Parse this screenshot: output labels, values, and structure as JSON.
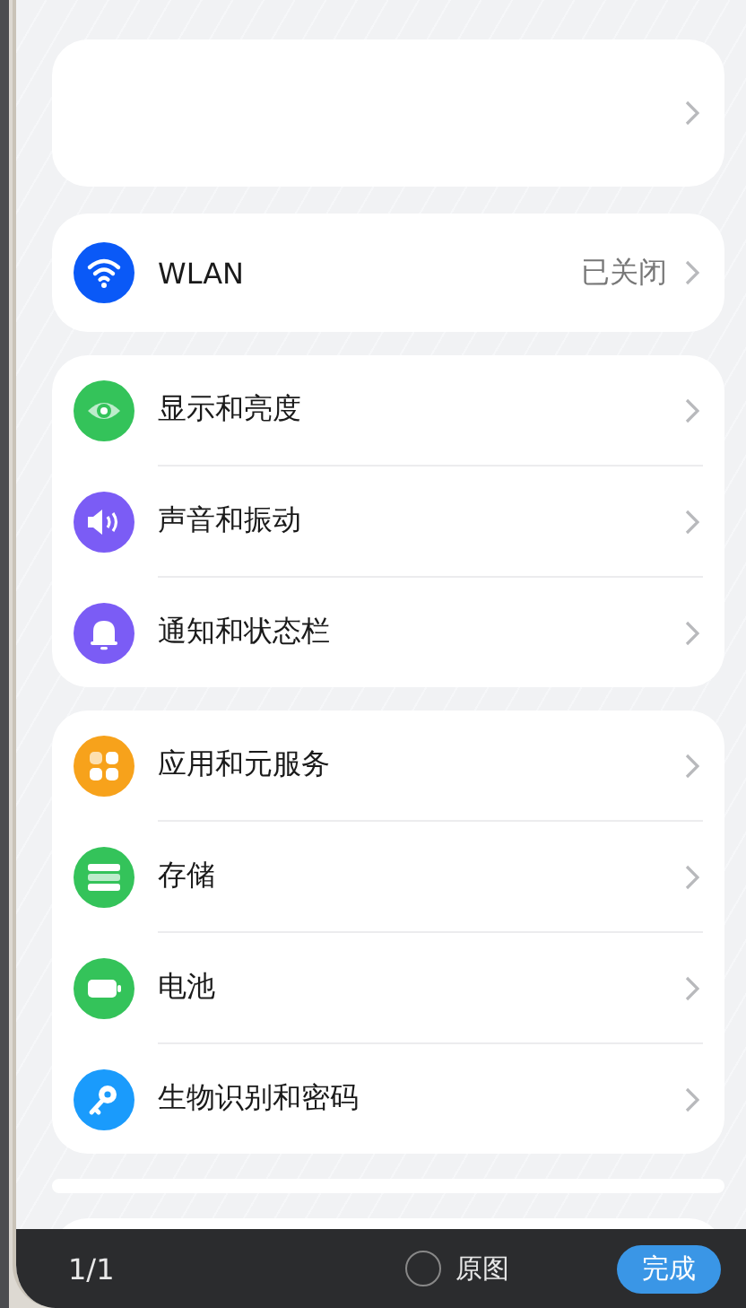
{
  "groups": [
    {
      "items": [
        {
          "kind": "empty"
        }
      ]
    },
    {
      "items": [
        {
          "kind": "wifi",
          "color": "#0a59f7",
          "label": "WLAN",
          "value": "已关闭"
        }
      ]
    },
    {
      "items": [
        {
          "kind": "eye",
          "color": "#34c35a",
          "label": "显示和亮度"
        },
        {
          "kind": "speaker",
          "color": "#7b5cf5",
          "label": "声音和振动"
        },
        {
          "kind": "bell",
          "color": "#7b5cf5",
          "label": "通知和状态栏"
        }
      ]
    },
    {
      "items": [
        {
          "kind": "apps",
          "color": "#f7a21b",
          "label": "应用和元服务"
        },
        {
          "kind": "storage",
          "color": "#34c35a",
          "label": "存储"
        },
        {
          "kind": "battery",
          "color": "#34c35a",
          "label": "电池"
        },
        {
          "kind": "key",
          "color": "#1a9bfc",
          "label": "生物识别和密码"
        }
      ]
    }
  ],
  "bottom_bar": {
    "counter": "1/1",
    "original_option": {
      "label": "原图",
      "selected": false
    },
    "done_button": "完成"
  }
}
